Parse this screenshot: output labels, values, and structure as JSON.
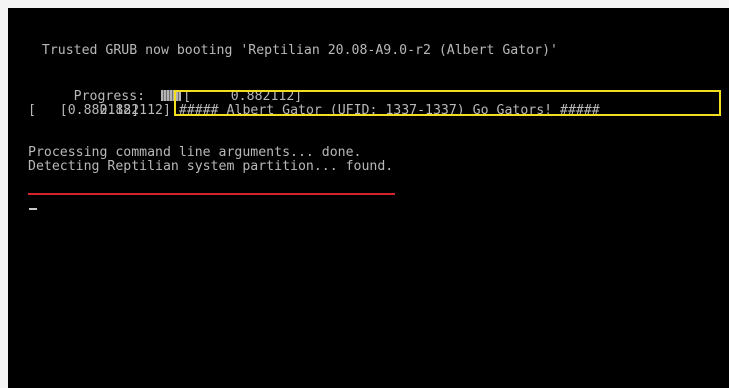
{
  "console": {
    "boot_title": "  Trusted GRUB now booting 'Reptilian 20.08-A9.0-r2 (Albert Gator)'",
    "progress_label": "  Progress:",
    "progress_overlap": "[     0.882112]",
    "log_line_1_prefix": "[    0.882112]",
    "log_line_1_message": "##### Albert Gator (UFID: 1337-1337) Go Gators! #####",
    "log_line_2": "[    0.882112]",
    "processing_line": "Processing command line arguments... done.",
    "detecting_line": "Detecting Reptilian system partition... found.",
    "cursor_glyph": "_"
  },
  "colors": {
    "console_background": "#000000",
    "console_text": "#b8b8b8",
    "highlight_box": "#f2dd1e",
    "underline_mark": "#d7232e"
  }
}
